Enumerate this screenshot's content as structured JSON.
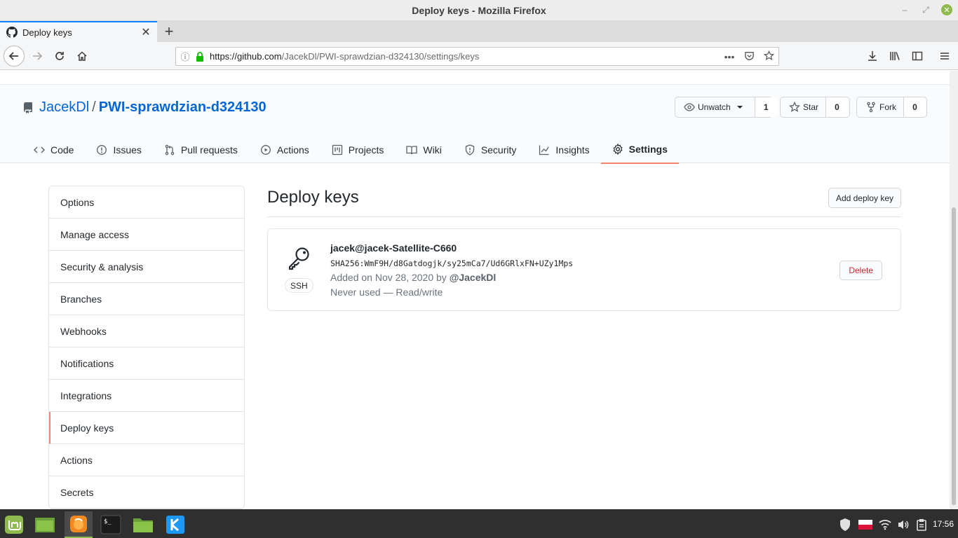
{
  "window": {
    "title": "Deploy keys - Mozilla Firefox"
  },
  "browser": {
    "tab_title": "Deploy keys",
    "url_domain": "https://github.com",
    "url_path": "/JacekDl/PWI-sprawdzian-d324130/settings/keys"
  },
  "repo": {
    "owner": "JacekDl",
    "separator": "/",
    "name": "PWI-sprawdzian-d324130",
    "watch_label": "Unwatch",
    "watch_count": "1",
    "star_label": "Star",
    "star_count": "0",
    "fork_label": "Fork",
    "fork_count": "0"
  },
  "repo_nav": [
    {
      "label": "Code",
      "icon": "code-icon"
    },
    {
      "label": "Issues",
      "icon": "issue-icon"
    },
    {
      "label": "Pull requests",
      "icon": "pull-request-icon"
    },
    {
      "label": "Actions",
      "icon": "play-icon"
    },
    {
      "label": "Projects",
      "icon": "project-icon"
    },
    {
      "label": "Wiki",
      "icon": "book-icon"
    },
    {
      "label": "Security",
      "icon": "shield-icon"
    },
    {
      "label": "Insights",
      "icon": "graph-icon"
    },
    {
      "label": "Settings",
      "icon": "gear-icon",
      "selected": true
    }
  ],
  "sidebar": {
    "items": [
      {
        "label": "Options"
      },
      {
        "label": "Manage access"
      },
      {
        "label": "Security & analysis"
      },
      {
        "label": "Branches"
      },
      {
        "label": "Webhooks"
      },
      {
        "label": "Notifications"
      },
      {
        "label": "Integrations"
      },
      {
        "label": "Deploy keys",
        "active": true
      },
      {
        "label": "Actions"
      },
      {
        "label": "Secrets"
      }
    ]
  },
  "main": {
    "heading": "Deploy keys",
    "add_button": "Add deploy key",
    "key": {
      "type": "SSH",
      "title": "jacek@jacek-Satellite-C660",
      "fingerprint": "SHA256:WmF9H/d8Gatdogjk/sy25mCa7/Ud6GRlxFN+UZy1Mps",
      "added_prefix": "Added on Nov 28, 2020 by",
      "added_by": "@JacekDl",
      "usage": "Never used — Read/write",
      "delete_label": "Delete"
    }
  },
  "taskbar": {
    "apps": [
      "mint-menu-icon",
      "file-manager-icon",
      "firefox-icon",
      "terminal-icon",
      "folder-icon",
      "kde-app-icon"
    ],
    "clock": "17:56"
  },
  "colors": {
    "link": "#0366d6",
    "selected_underline": "#f9826c",
    "danger": "#cb2431",
    "taskbar": "#2f2f2f"
  }
}
